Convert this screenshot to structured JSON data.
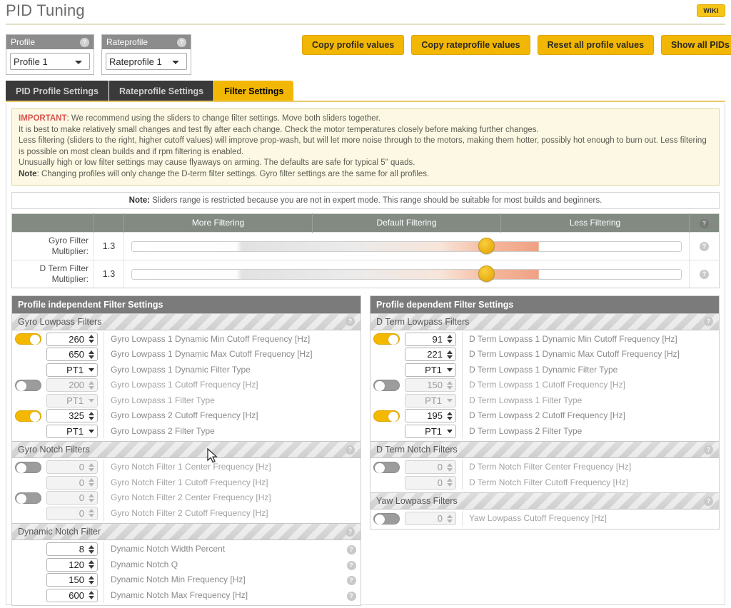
{
  "header": {
    "title": "PID Tuning",
    "wiki_label": "WIKI"
  },
  "profile_selectors": [
    {
      "name": "profile",
      "header": "Profile",
      "value": "Profile 1"
    },
    {
      "name": "rateprofile",
      "header": "Rateprofile",
      "value": "Rateprofile 1"
    }
  ],
  "top_buttons": [
    {
      "label": "Copy profile values"
    },
    {
      "label": "Copy rateprofile values"
    },
    {
      "label": "Reset all profile values"
    },
    {
      "label": "Show all PIDs"
    }
  ],
  "tabs": [
    {
      "label": "PID Profile Settings",
      "active": false
    },
    {
      "label": "Rateprofile Settings",
      "active": false
    },
    {
      "label": "Filter Settings",
      "active": true
    }
  ],
  "important_note": {
    "keyword": "IMPORTANT",
    "line1": ": We recommend using the sliders to change filter settings. Move both sliders together.",
    "line2": "It is best to make relatively small changes and test fly after each change. Check the motor temperatures closely before making further changes.",
    "line3": "Less filtering (sliders to the right, higher cutoff values) will improve prop-wash, but will let more noise through to the motors, making them hotter, possibly hot enough to burn out. Less filtering is possible on most clean builds and if rpm filtering is enabled.",
    "line4": "Unusually high or low filter settings may cause flyaways on arming. The defaults are safe for typical 5\" quads.",
    "note_keyword": "Note",
    "line5": ": Changing profiles will only change the D-term filter settings. Gyro filter settings are the same for all profiles."
  },
  "slider_note": {
    "keyword": "Note:",
    "text": " Sliders range is restricted because you are not in expert mode. This range should be suitable for most builds and beginners."
  },
  "slider_table": {
    "headers": [
      "More Filtering",
      "Default Filtering",
      "Less Filtering"
    ],
    "rows": [
      {
        "label_line1": "Gyro Filter",
        "label_line2": "Multiplier:",
        "value": "1.3",
        "thumb_pct": 64.5,
        "fill_pct": 74
      },
      {
        "label_line1": "D Term Filter",
        "label_line2": "Multiplier:",
        "value": "1.3",
        "thumb_pct": 64.5,
        "fill_pct": 74
      }
    ]
  },
  "panels": [
    {
      "title": "Profile independent Filter Settings",
      "groups": [
        {
          "name": "Gyro Lowpass Filters",
          "rows": [
            {
              "toggle": "on",
              "kind": "number",
              "value": "260",
              "label": "Gyro Lowpass 1 Dynamic Min Cutoff Frequency [Hz]",
              "disabled": false,
              "help": false
            },
            {
              "toggle": "none",
              "kind": "number",
              "value": "650",
              "label": "Gyro Lowpass 1 Dynamic Max Cutoff Frequency [Hz]",
              "disabled": false,
              "help": false
            },
            {
              "toggle": "none",
              "kind": "select",
              "value": "PT1",
              "label": "Gyro Lowpass 1 Dynamic Filter Type",
              "disabled": false,
              "help": false
            },
            {
              "toggle": "off",
              "kind": "number",
              "value": "200",
              "label": "Gyro Lowpass 1 Cutoff Frequency [Hz]",
              "disabled": true,
              "help": false
            },
            {
              "toggle": "none",
              "kind": "select",
              "value": "PT1",
              "label": "Gyro Lowpass 1 Filter Type",
              "disabled": true,
              "help": false
            },
            {
              "toggle": "on",
              "kind": "number",
              "value": "325",
              "label": "Gyro Lowpass 2 Cutoff Frequency [Hz]",
              "disabled": false,
              "help": false
            },
            {
              "toggle": "none",
              "kind": "select",
              "value": "PT1",
              "label": "Gyro Lowpass 2 Filter Type",
              "disabled": false,
              "help": false
            }
          ]
        },
        {
          "name": "Gyro Notch Filters",
          "rows": [
            {
              "toggle": "off",
              "kind": "number",
              "value": "0",
              "label": "Gyro Notch Filter 1 Center Frequency [Hz]",
              "disabled": true,
              "help": false
            },
            {
              "toggle": "none",
              "kind": "number",
              "value": "0",
              "label": "Gyro Notch Filter 1 Cutoff Frequency [Hz]",
              "disabled": true,
              "help": false
            },
            {
              "toggle": "off",
              "kind": "number",
              "value": "0",
              "label": "Gyro Notch Filter 2 Center Frequency [Hz]",
              "disabled": true,
              "help": false
            },
            {
              "toggle": "none",
              "kind": "number",
              "value": "0",
              "label": "Gyro Notch Filter 2 Cutoff Frequency [Hz]",
              "disabled": true,
              "help": false
            }
          ]
        },
        {
          "name": "Dynamic Notch Filter",
          "rows": [
            {
              "toggle": "none",
              "kind": "number",
              "value": "8",
              "label": "Dynamic Notch Width Percent",
              "disabled": false,
              "help": true
            },
            {
              "toggle": "none",
              "kind": "number",
              "value": "120",
              "label": "Dynamic Notch Q",
              "disabled": false,
              "help": true
            },
            {
              "toggle": "none",
              "kind": "number",
              "value": "150",
              "label": "Dynamic Notch Min Frequency [Hz]",
              "disabled": false,
              "help": true
            },
            {
              "toggle": "none",
              "kind": "number",
              "value": "600",
              "label": "Dynamic Notch Max Frequency [Hz]",
              "disabled": false,
              "help": true
            }
          ]
        }
      ]
    },
    {
      "title": "Profile dependent Filter Settings",
      "groups": [
        {
          "name": "D Term Lowpass Filters",
          "rows": [
            {
              "toggle": "on",
              "kind": "number",
              "value": "91",
              "label": "D Term Lowpass 1 Dynamic Min Cutoff Frequency [Hz]",
              "disabled": false,
              "help": false
            },
            {
              "toggle": "none",
              "kind": "number",
              "value": "221",
              "label": "D Term Lowpass 1 Dynamic Max Cutoff Frequency [Hz]",
              "disabled": false,
              "help": false
            },
            {
              "toggle": "none",
              "kind": "select",
              "value": "PT1",
              "label": "D Term Lowpass 1 Dynamic Filter Type",
              "disabled": false,
              "help": false
            },
            {
              "toggle": "off",
              "kind": "number",
              "value": "150",
              "label": "D Term Lowpass 1 Cutoff Frequency [Hz]",
              "disabled": true,
              "help": false
            },
            {
              "toggle": "none",
              "kind": "select",
              "value": "PT1",
              "label": "D Term Lowpass 1 Filter Type",
              "disabled": true,
              "help": false
            },
            {
              "toggle": "on",
              "kind": "number",
              "value": "195",
              "label": "D Term Lowpass 2 Cutoff Frequency [Hz]",
              "disabled": false,
              "help": false
            },
            {
              "toggle": "none",
              "kind": "select",
              "value": "PT1",
              "label": "D Term Lowpass 2 Filter Type",
              "disabled": false,
              "help": false
            }
          ]
        },
        {
          "name": "D Term Notch Filters",
          "rows": [
            {
              "toggle": "off",
              "kind": "number",
              "value": "0",
              "label": "D Term Notch Filter Center Frequency [Hz]",
              "disabled": true,
              "help": false
            },
            {
              "toggle": "none",
              "kind": "number",
              "value": "0",
              "label": "D Term Notch Filter Cutoff Frequency [Hz]",
              "disabled": true,
              "help": false
            }
          ]
        },
        {
          "name": "Yaw Lowpass Filters",
          "rows": [
            {
              "toggle": "off",
              "kind": "number",
              "value": "0",
              "label": "Yaw Lowpass Cutoff Frequency [Hz]",
              "disabled": true,
              "help": false
            }
          ]
        }
      ]
    }
  ],
  "colors": {
    "accent_amber": "#f2b705",
    "toggle_on": "#f5b800",
    "toggle_off": "#9c9c9c",
    "tab_dark": "#3a3a3a",
    "panel_header_gray": "#7b7b7b",
    "note_yellow_bg": "#fcf8e3",
    "important_red": "#d9534f"
  }
}
